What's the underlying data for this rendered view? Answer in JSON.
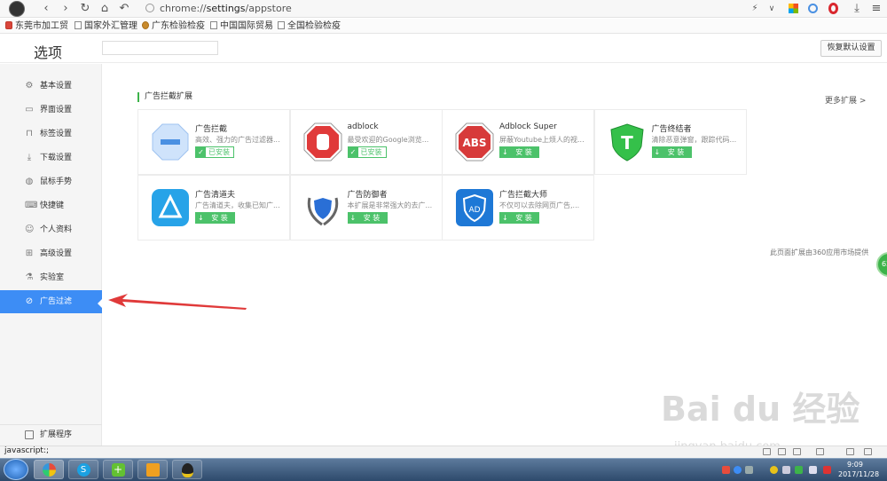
{
  "browser": {
    "url_prefix": "chrome://",
    "url_path": "settings",
    "url_suffix": "/appstore"
  },
  "bookmarks": [
    "东莞市加工贸",
    "国家外汇管理",
    "广东检验检疫",
    "中国国际贸易",
    "全国检验检疫"
  ],
  "header": {
    "title": "选项",
    "restore_label": "恢复默认设置"
  },
  "sidebar": {
    "items": [
      {
        "label": "基本设置",
        "icon": "gear-icon",
        "glyph": "⚙"
      },
      {
        "label": "界面设置",
        "icon": "window-icon",
        "glyph": "▭"
      },
      {
        "label": "标签设置",
        "icon": "tab-icon",
        "glyph": "⊓"
      },
      {
        "label": "下载设置",
        "icon": "download-icon",
        "glyph": "⤓"
      },
      {
        "label": "鼠标手势",
        "icon": "mouse-icon",
        "glyph": "◍"
      },
      {
        "label": "快捷键",
        "icon": "keyboard-icon",
        "glyph": "⌨"
      },
      {
        "label": "个人资料",
        "icon": "user-icon",
        "glyph": "☺"
      },
      {
        "label": "高级设置",
        "icon": "advanced-icon",
        "glyph": "⊞"
      },
      {
        "label": "实验室",
        "icon": "flask-icon",
        "glyph": "⚗"
      },
      {
        "label": "广告过滤",
        "icon": "block-icon",
        "glyph": "⊘"
      }
    ],
    "active_index": 9,
    "footer_label": "扩展程序"
  },
  "main": {
    "section_title": "广告拦截扩展",
    "more_label": "更多扩展 >",
    "extensions": [
      {
        "name": "广告拦截",
        "desc": "高效、强力的广告过滤器...",
        "status": "已安装",
        "installed": true
      },
      {
        "name": "adblock",
        "desc": "最受欢迎的Google浏览...",
        "status": "已安装",
        "installed": true
      },
      {
        "name": "Adblock Super",
        "desc": "屏蔽Youtube上烦人的视...",
        "status": "安 装",
        "installed": false
      },
      {
        "name": "广告终结者",
        "desc": "清除恶意弹窗，跟踪代码...",
        "status": "安 装",
        "installed": false
      },
      {
        "name": "广告清道夫",
        "desc": "广告清道夫，收集已知广...",
        "status": "安 装",
        "installed": false
      },
      {
        "name": "广告防御者",
        "desc": "本扩展是非常强大的去广...",
        "status": "安 装",
        "installed": false
      },
      {
        "name": "广告拦截大师",
        "desc": "不仅可以去除网页广告,...",
        "status": "安 装",
        "installed": false
      }
    ],
    "provider_note": "此页面扩展由360应用市场提供"
  },
  "statusbar": {
    "text": "javascript:;"
  },
  "taskbar": {
    "time": "9:09",
    "date": "2017/11/28"
  },
  "floatball": {
    "text": "62"
  },
  "watermark": {
    "text": "Bai du 经验",
    "sub": "jingyan.baidu.com"
  },
  "colors": {
    "accent": "#3d8df5",
    "install_green": "#4cc26a",
    "annotation_red": "#e03a3a"
  }
}
